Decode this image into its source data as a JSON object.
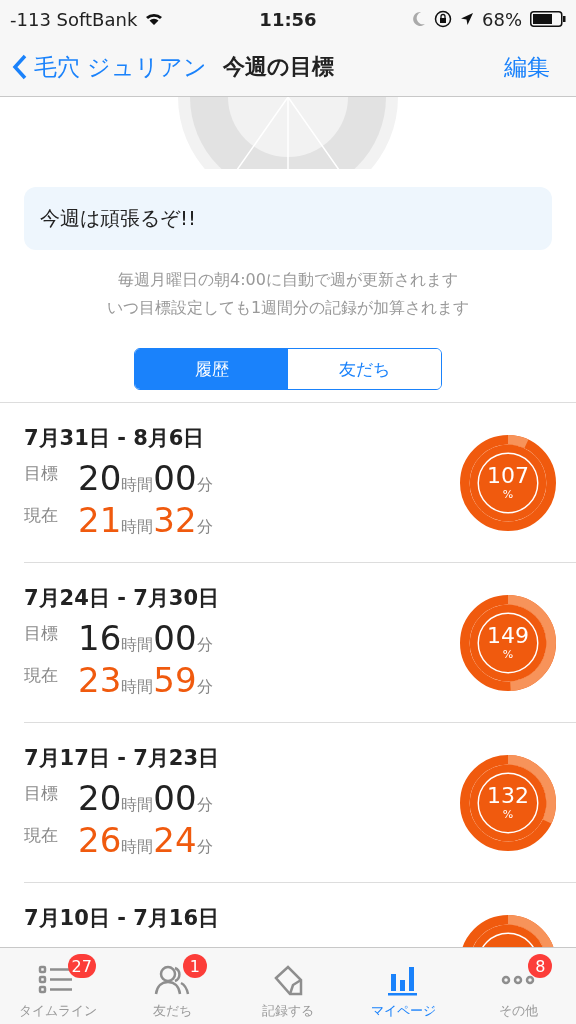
{
  "status_bar": {
    "carrier": "-113 SoftBank",
    "time": "11:56",
    "battery": "68%"
  },
  "nav": {
    "back": "毛穴 ジュリアン",
    "title": "今週の目標",
    "action": "編集"
  },
  "memo": "今週は頑張るぞ!!",
  "info": [
    "毎週月曜日の朝4:00に自動で週が更新されます",
    "いつ目標設定しても1週間分の記録が加算されます"
  ],
  "segments": [
    {
      "label": "履歴",
      "selected": true
    },
    {
      "label": "友だち",
      "selected": false
    }
  ],
  "weeks": [
    {
      "range": "7月31日 - 8月6日",
      "goal_label": "目標",
      "goal_hours": "20",
      "goal_hour_unit": "時間",
      "goal_minutes": "00",
      "goal_minute_unit": "分",
      "current_label": "現在",
      "current_hours": "21",
      "current_hour_unit": "時間",
      "current_minutes": "32",
      "current_minute_unit": "分",
      "percent": "107",
      "percent_unit": "%",
      "level": 0.07
    },
    {
      "range": "7月24日 - 7月30日",
      "goal_label": "目標",
      "goal_hours": "16",
      "goal_hour_unit": "時間",
      "goal_minutes": "00",
      "goal_minute_unit": "分",
      "current_label": "現在",
      "current_hours": "23",
      "current_hour_unit": "時間",
      "current_minutes": "59",
      "current_minute_unit": "分",
      "percent": "149",
      "percent_unit": "%",
      "level": 0.49
    },
    {
      "range": "7月17日 - 7月23日",
      "goal_label": "目標",
      "goal_hours": "20",
      "goal_hour_unit": "時間",
      "goal_minutes": "00",
      "goal_minute_unit": "分",
      "current_label": "現在",
      "current_hours": "26",
      "current_hour_unit": "時間",
      "current_minutes": "24",
      "current_minute_unit": "分",
      "percent": "132",
      "percent_unit": "%",
      "level": 0.32
    },
    {
      "range": "7月10日 - 7月16日"
    }
  ],
  "tabs": [
    {
      "label": "タイムライン",
      "badge": "27",
      "selected": false,
      "kind": "list"
    },
    {
      "label": "友だち",
      "badge": "1",
      "selected": false,
      "kind": "people"
    },
    {
      "label": "記録する",
      "selected": false,
      "kind": "record"
    },
    {
      "label": "マイページ",
      "selected": true,
      "kind": "chart"
    },
    {
      "label": "その他",
      "badge": "8",
      "selected": false,
      "kind": "more"
    }
  ]
}
